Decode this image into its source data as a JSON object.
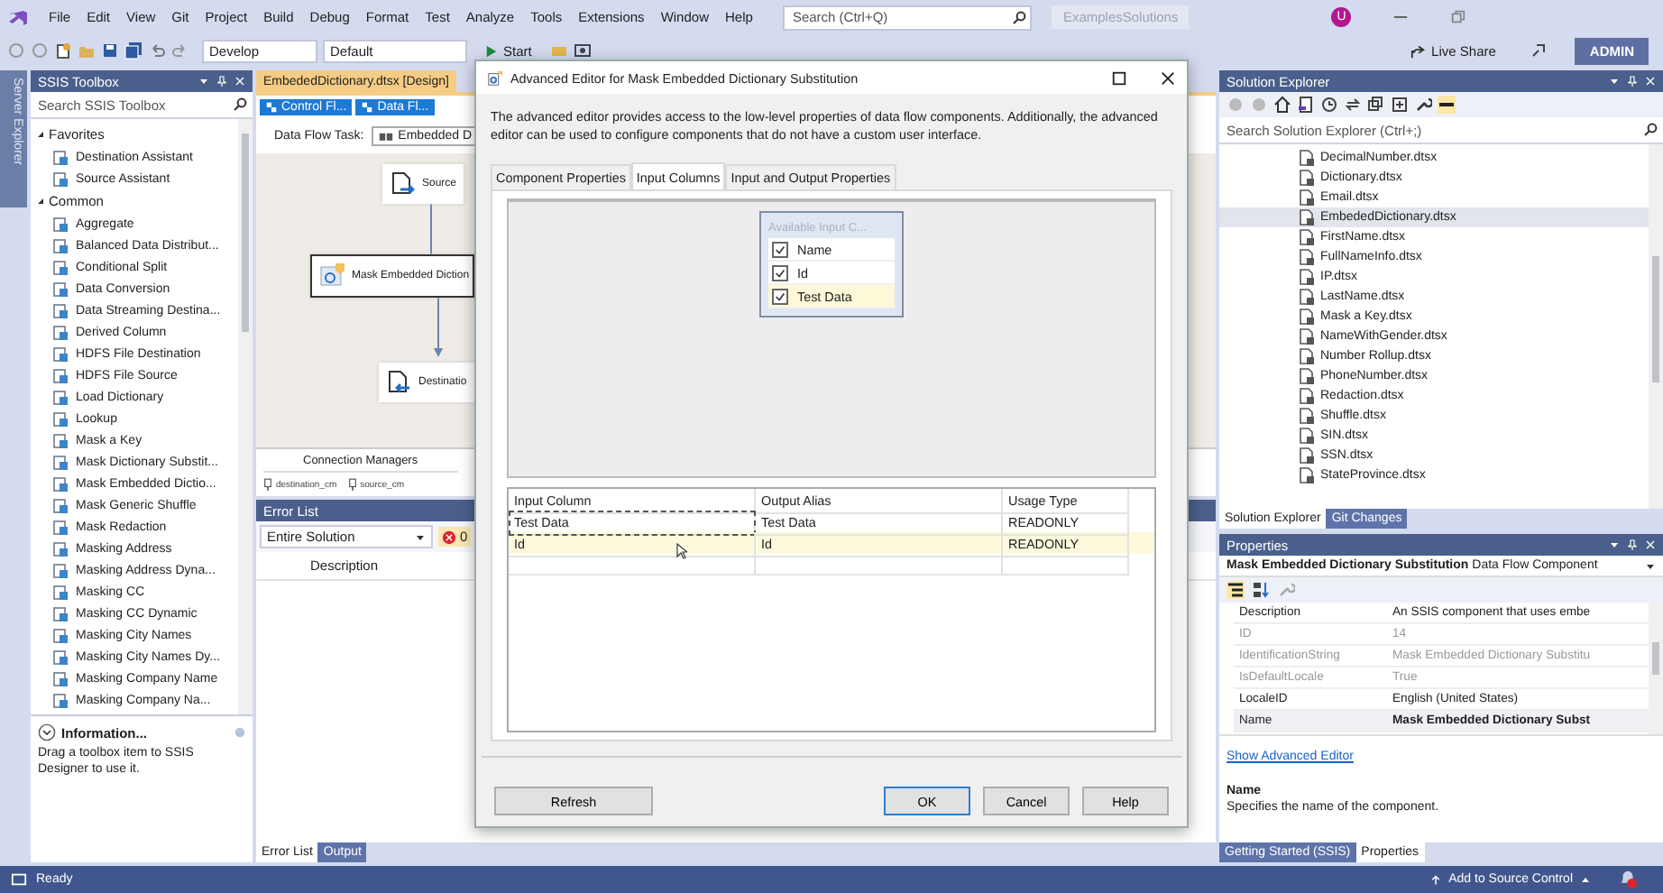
{
  "menu_bar": {
    "items": [
      "File",
      "Edit",
      "View",
      "Git",
      "Project",
      "Build",
      "Debug",
      "Format",
      "Test",
      "Analyze",
      "Tools",
      "Extensions",
      "Window",
      "Help"
    ],
    "search": {
      "placeholder": "Search (Ctrl+Q)"
    },
    "solution_name": "ExamplesSolutions",
    "avatar": "U"
  },
  "toolbar": {
    "configuration": "Develop",
    "platform": "Default",
    "start": "Start",
    "live_share": "Live Share",
    "account": "ADMIN"
  },
  "side_tab": "Server Explorer",
  "toolbox": {
    "title": "SSIS Toolbox",
    "search": {
      "placeholder": "Search SSIS Toolbox"
    },
    "groups": [
      {
        "label": "Favorites",
        "expanded": true,
        "items": [
          "Destination Assistant",
          "Source Assistant"
        ]
      },
      {
        "label": "Common",
        "expanded": true,
        "items": [
          "Aggregate",
          "Balanced Data Distribut...",
          "Conditional Split",
          "Data Conversion",
          "Data Streaming Destina...",
          "Derived Column",
          "HDFS File Destination",
          "HDFS File Source",
          "Load Dictionary",
          "Lookup",
          "Mask a Key",
          "Mask Dictionary Substit...",
          "Mask Embedded Dictio...",
          "Mask Generic Shuffle",
          "Mask Redaction",
          "Masking Address",
          "Masking Address Dyna...",
          "Masking CC",
          "Masking CC Dynamic",
          "Masking City Names",
          "Masking City Names Dy...",
          "Masking Company Name",
          "Masking Company Na..."
        ]
      }
    ],
    "info": {
      "title": "Information...",
      "text": "Drag a toolbox item to SSIS Designer to use it."
    }
  },
  "designer": {
    "document_tab": "EmbededDictionary.dtsx [Design]",
    "view_tabs": [
      "Control Fl...",
      "Data Fl..."
    ],
    "task_label": "Data Flow Task:",
    "task_value": "Embedded D",
    "nodes": [
      {
        "kind": "source",
        "label": "Source"
      },
      {
        "kind": "transform",
        "label": "Mask Embedded Diction"
      },
      {
        "kind": "destination",
        "label": "Destinatio"
      }
    ],
    "connection_managers": {
      "title": "Connection Managers",
      "items": [
        "destination_cm",
        "source_cm"
      ]
    }
  },
  "error_list": {
    "title": "Error List",
    "scope": "Entire Solution",
    "errors": "0",
    "columns": [
      "Description"
    ],
    "tabs": [
      {
        "label": "Error List",
        "selected": true
      },
      {
        "label": "Output",
        "selected": false
      }
    ]
  },
  "dialog": {
    "title": "Advanced Editor for Mask Embedded Dictionary Substitution",
    "description": "The advanced editor provides access to the low-level properties of data flow components. Additionally, the advanced editor can be used to configure components that do not have a custom user interface.",
    "tabs": [
      {
        "label": "Component Properties",
        "selected": false
      },
      {
        "label": "Input Columns",
        "selected": true
      },
      {
        "label": "Input and Output Properties",
        "selected": false
      }
    ],
    "available_columns": {
      "title": "Available Input C...",
      "items": [
        {
          "label": "Name",
          "checked": true,
          "selected": false
        },
        {
          "label": "Id",
          "checked": true,
          "selected": false
        },
        {
          "label": "Test Data",
          "checked": true,
          "selected": true
        }
      ]
    },
    "grid": {
      "columns": [
        "Input Column",
        "Output Alias",
        "Usage Type"
      ],
      "rows": [
        {
          "cells": [
            "Test Data",
            "Test Data",
            "READONLY"
          ],
          "selected": false,
          "focused": true
        },
        {
          "cells": [
            "Id",
            "Id",
            "READONLY"
          ],
          "selected": true,
          "focused": false
        }
      ]
    },
    "buttons": [
      {
        "label": "Refresh",
        "default": false
      },
      {
        "label": "OK",
        "default": true
      },
      {
        "label": "Cancel",
        "default": false
      },
      {
        "label": "Help",
        "default": false
      }
    ]
  },
  "solution_explorer": {
    "title": "Solution Explorer",
    "search": {
      "placeholder": "Search Solution Explorer (Ctrl+;)"
    },
    "items": [
      {
        "label": "DecimalNumber.dtsx",
        "selected": false
      },
      {
        "label": "Dictionary.dtsx",
        "selected": false
      },
      {
        "label": "Email.dtsx",
        "selected": false
      },
      {
        "label": "EmbededDictionary.dtsx",
        "selected": true
      },
      {
        "label": "FirstName.dtsx",
        "selected": false
      },
      {
        "label": "FullNameInfo.dtsx",
        "selected": false
      },
      {
        "label": "IP.dtsx",
        "selected": false
      },
      {
        "label": "LastName.dtsx",
        "selected": false
      },
      {
        "label": "Mask a Key.dtsx",
        "selected": false
      },
      {
        "label": "NameWithGender.dtsx",
        "selected": false
      },
      {
        "label": "Number Rollup.dtsx",
        "selected": false
      },
      {
        "label": "PhoneNumber.dtsx",
        "selected": false
      },
      {
        "label": "Redaction.dtsx",
        "selected": false
      },
      {
        "label": "Shuffle.dtsx",
        "selected": false
      },
      {
        "label": "SIN.dtsx",
        "selected": false
      },
      {
        "label": "SSN.dtsx",
        "selected": false
      },
      {
        "label": "StateProvince.dtsx",
        "selected": false
      }
    ],
    "tabs": [
      {
        "label": "Solution Explorer",
        "selected": true
      },
      {
        "label": "Git Changes",
        "selected": false
      }
    ]
  },
  "properties": {
    "title": "Properties",
    "object_name": "Mask Embedded Dictionary Substitution",
    "object_type": "Data Flow Component",
    "rows": [
      {
        "name": "Description",
        "value": "An SSIS component that uses embe",
        "disabled": false,
        "selected": false
      },
      {
        "name": "ID",
        "value": "14",
        "disabled": true,
        "selected": false
      },
      {
        "name": "IdentificationString",
        "value": "Mask Embedded Dictionary Substitu",
        "disabled": true,
        "selected": false
      },
      {
        "name": "IsDefaultLocale",
        "value": "True",
        "disabled": true,
        "selected": false
      },
      {
        "name": "LocaleID",
        "value": "English (United States)",
        "disabled": false,
        "selected": false
      },
      {
        "name": "Name",
        "value": "Mask Embedded Dictionary Subst",
        "disabled": false,
        "selected": true
      }
    ],
    "link": "Show Advanced Editor",
    "help_title": "Name",
    "help_text": "Specifies the name of the component.",
    "tabs": [
      {
        "label": "Getting Started (SSIS)",
        "selected": false
      },
      {
        "label": "Properties",
        "selected": true
      }
    ]
  },
  "status_bar": {
    "text": "Ready",
    "source_control": "Add to Source Control"
  }
}
